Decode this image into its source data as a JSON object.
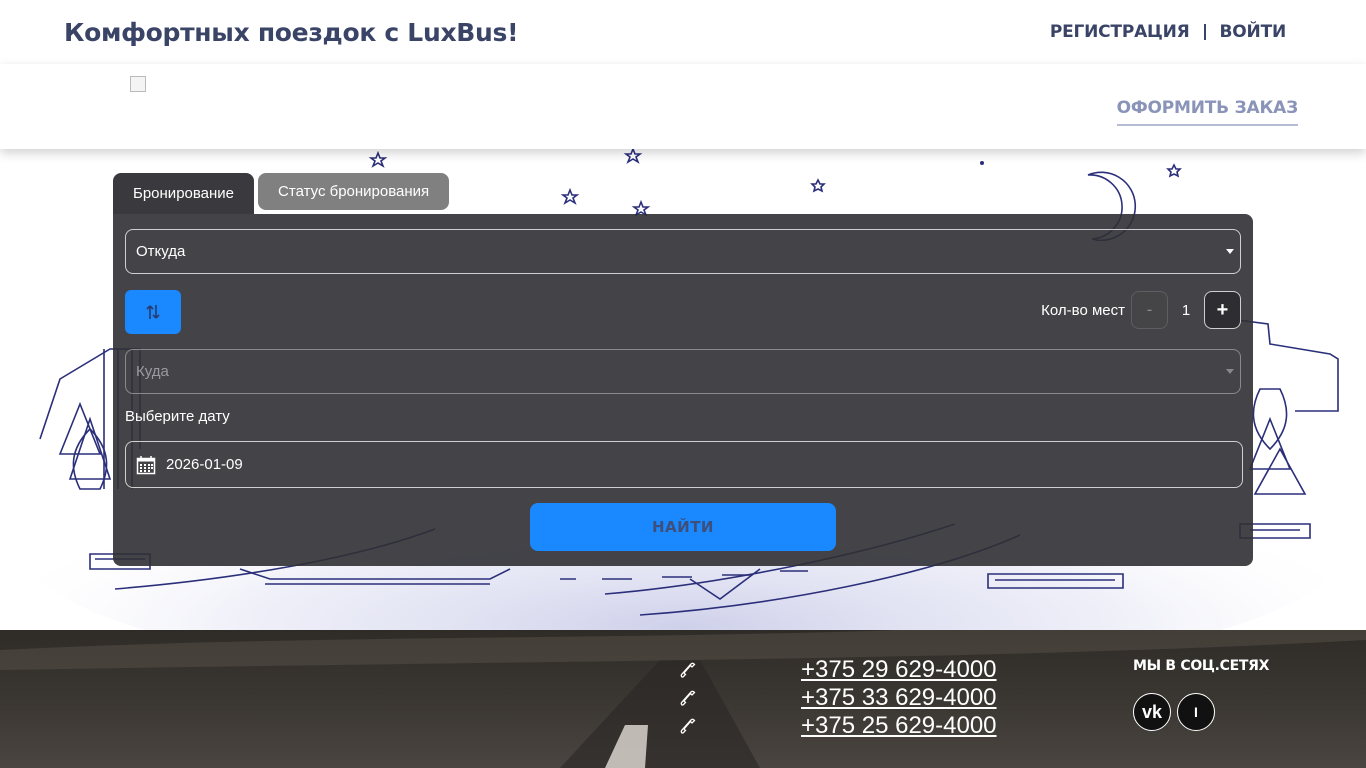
{
  "header": {
    "title": "Комфортных поездок с LuxBus!",
    "register_label": "РЕГИСТРАЦИЯ",
    "login_label": "ВОЙТИ"
  },
  "navbar": {
    "logo_icon": "broken-image-icon",
    "order_label": "ОФОРМИТЬ ЗАКАЗ"
  },
  "booking": {
    "tabs": [
      {
        "label": "Бронирование",
        "active": true
      },
      {
        "label": "Статус бронирования",
        "active": false
      }
    ],
    "from_placeholder": "Откуда",
    "to_placeholder": "Куда",
    "swap_icon": "swap-arrows-icon",
    "seats_label": "Кол-во мест",
    "seats_minus": "-",
    "seats_value": "1",
    "seats_plus": "+",
    "date_label": "Выберите дату",
    "date_value": "2026-01-09",
    "date_icon": "calendar-icon",
    "find_label": "НАЙТИ"
  },
  "footer": {
    "phones": [
      "+375 29 629-4000",
      "+375 33 629-4000",
      "+375 25 629-4000"
    ],
    "social_title": "МЫ В СОЦ.СЕТЯХ",
    "social_vk": "vk",
    "social_instagram": "I"
  },
  "colors": {
    "accent": "#1a88ff",
    "title": "#3a4466",
    "panel": "#303034",
    "nav_link": "#8a93b8"
  }
}
